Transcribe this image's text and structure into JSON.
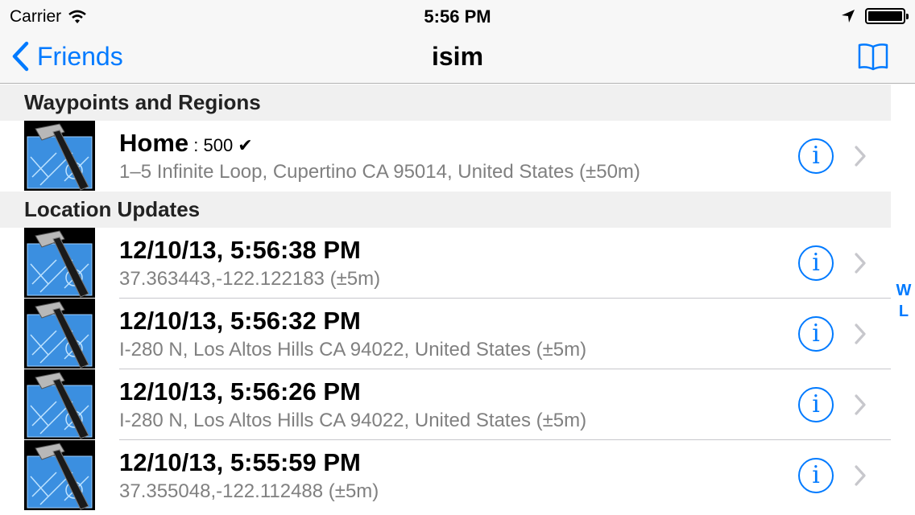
{
  "status_bar": {
    "carrier": "Carrier",
    "time": "5:56 PM",
    "battery_level": 1.0
  },
  "nav": {
    "back_label": "Friends",
    "title": "isim",
    "right_icon": "book-icon"
  },
  "sections": [
    {
      "header": "Waypoints and Regions",
      "rows": [
        {
          "title": "Home",
          "suffix": " : 500 ✔",
          "subtitle": "1–5 Infinite Loop, Cupertino CA 95014, United States (±50m)"
        }
      ]
    },
    {
      "header": "Location Updates",
      "rows": [
        {
          "title": "12/10/13, 5:56:38 PM",
          "subtitle": "37.363443,-122.122183 (±5m)"
        },
        {
          "title": "12/10/13, 5:56:32 PM",
          "subtitle": "I-280 N, Los Altos Hills CA 94022, United States (±5m)"
        },
        {
          "title": "12/10/13, 5:56:26 PM",
          "subtitle": "I-280 N, Los Altos Hills CA 94022, United States (±5m)"
        },
        {
          "title": "12/10/13, 5:55:59 PM",
          "subtitle": "37.355048,-122.112488 (±5m)"
        }
      ]
    }
  ],
  "info_glyph": "i",
  "section_index": [
    "W",
    "L"
  ],
  "colors": {
    "accent": "#007aff",
    "subtitle": "#808080",
    "section_bg": "#f0f0f0"
  }
}
